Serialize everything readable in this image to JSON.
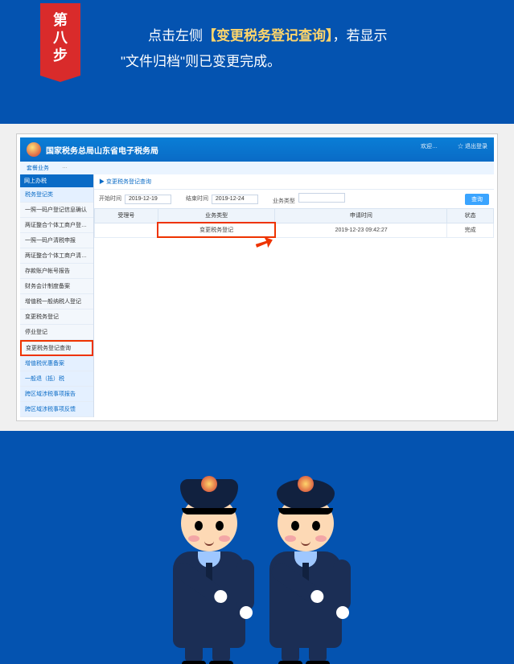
{
  "step_label": "第\n八\n步",
  "instruction_prefix": "　　点击左侧",
  "instruction_em": "【变更税务登记查询】",
  "instruction_mid": "，若显示",
  "instruction_quote": "\"文件归档\"",
  "instruction_suffix": "则已变更完成。",
  "app": {
    "title": "国家税务总局山东省电子税务局",
    "user_area": "欢迎…",
    "logout": "☆ 退出登录",
    "tabs": [
      "套餐业务",
      "…"
    ],
    "side_header1": "网上办税",
    "side_header2": "税务登记类",
    "side_items": [
      "一照一码户登记信息确认",
      "两证整合个体工商户登记信息确认",
      "一照一码户清税申报",
      "两证整合个体工商户清税申报",
      "存款账户帐号报告",
      "财务会计制度备案",
      "增值税一般纳税人登记",
      "变更税务登记",
      "停业登记",
      "变更税务登记查询"
    ],
    "side_tail": [
      "增值税优惠备案",
      "一般退（抵）税",
      "跨区域涉税事项报告",
      "跨区域涉税事项反馈"
    ],
    "crumb": "▶ 变更税务登记查询",
    "filters": {
      "f1_label": "开始时间",
      "f1_value": "2019-12-19",
      "f2_label": "结束时间",
      "f2_value": "2019-12-24",
      "f3_label": "业务类型",
      "query_btn": "查询"
    },
    "table": {
      "headers": [
        "受理号",
        "业务类型",
        "申请时间",
        "状态"
      ],
      "row": [
        "",
        "变更税务登记",
        "2019-12-23 09:42:27",
        "完成"
      ]
    }
  }
}
